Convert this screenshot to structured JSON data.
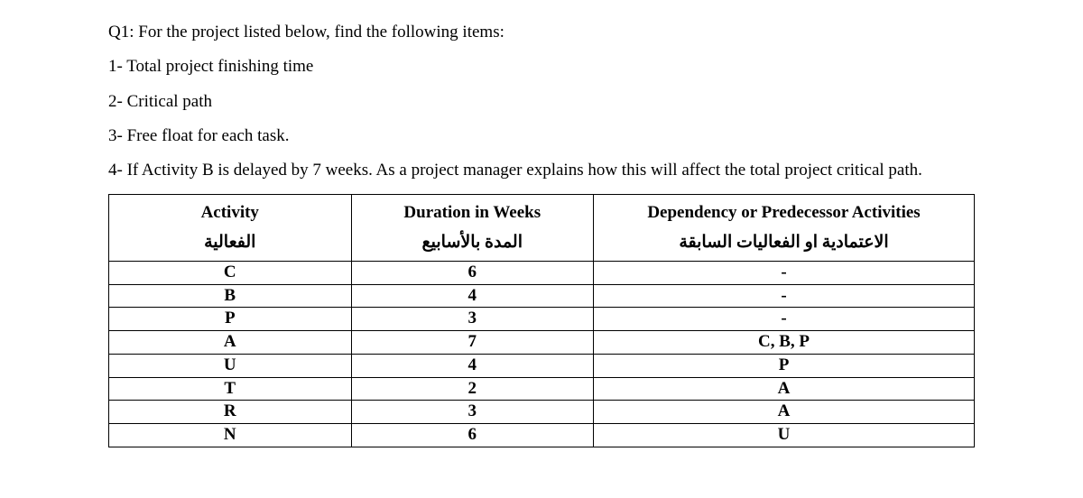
{
  "question": {
    "title": "Q1: For the project listed below, find the following items:",
    "item1": "1- Total project finishing time",
    "item2": "2- Critical path",
    "item3": "3- Free float for each task.",
    "item4": "4- If Activity B is delayed by 7 weeks. As a project manager explains how this will affect the total project critical path."
  },
  "table": {
    "headers": {
      "activity_en": "Activity",
      "activity_ar": "الفعالية",
      "duration_en": "Duration in Weeks",
      "duration_ar": "المدة بالأسابيع",
      "dependency_en": "Dependency or Predecessor Activities",
      "dependency_ar": "الاعتمادية او الفعاليات السابقة"
    },
    "rows": [
      {
        "activity": "C",
        "duration": "6",
        "dependency": "-"
      },
      {
        "activity": "B",
        "duration": "4",
        "dependency": "-"
      },
      {
        "activity": "P",
        "duration": "3",
        "dependency": "-"
      },
      {
        "activity": "A",
        "duration": "7",
        "dependency": "C, B, P"
      },
      {
        "activity": "U",
        "duration": "4",
        "dependency": "P"
      },
      {
        "activity": "T",
        "duration": "2",
        "dependency": "A"
      },
      {
        "activity": "R",
        "duration": "3",
        "dependency": "A"
      },
      {
        "activity": "N",
        "duration": "6",
        "dependency": "U"
      }
    ]
  }
}
